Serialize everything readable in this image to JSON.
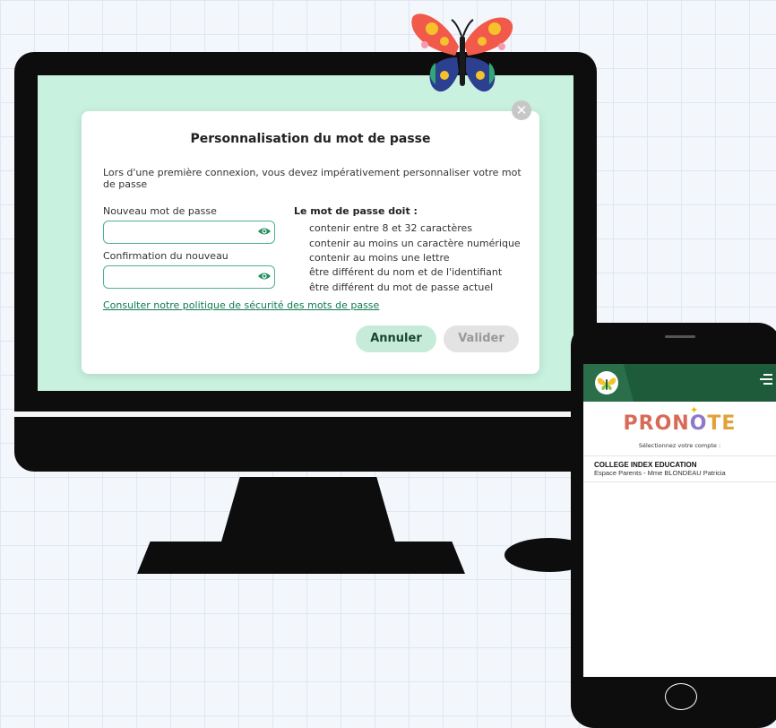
{
  "dialog": {
    "title": "Personnalisation du mot de passe",
    "intro": "Lors d'une première connexion, vous devez impérativement personnaliser votre mot de passe",
    "new_password_label": "Nouveau mot de passe",
    "new_password_value": "",
    "confirm_label": "Confirmation du nouveau",
    "confirm_value": "",
    "rules_title": "Le mot de passe doit :",
    "rules": [
      "contenir entre 8 et 32 caractères",
      "contenir au moins un caractère numérique",
      "contenir au moins une lettre",
      "être différent du nom et de l'identifiant",
      "être différent du mot de passe actuel"
    ],
    "policy_link": "Consulter notre politique de sécurité des mots de passe",
    "cancel_label": "Annuler",
    "validate_label": "Valider",
    "close_symbol": "✕"
  },
  "phone": {
    "app_name_parts": [
      "PRON",
      "O",
      "TE"
    ],
    "app_name_colors": [
      "#d96a57",
      "#7fb4de",
      "#7bbf5a",
      "#e2a23a",
      "#8f78c9",
      "#d96a57"
    ],
    "prompt": "Sélectionnez votre compte :",
    "school": "COLLEGE INDEX EDUCATION",
    "account": "Espace Parents - Mme BLONDEAU Patricia"
  },
  "icons": {
    "eye": "eye-icon",
    "close": "close-icon",
    "menu": "menu-icon",
    "butterfly": "butterfly-logo"
  },
  "colors": {
    "accent_green": "#1e5b3a",
    "screen_mint": "#c9f1df",
    "field_border": "#4db38c"
  }
}
